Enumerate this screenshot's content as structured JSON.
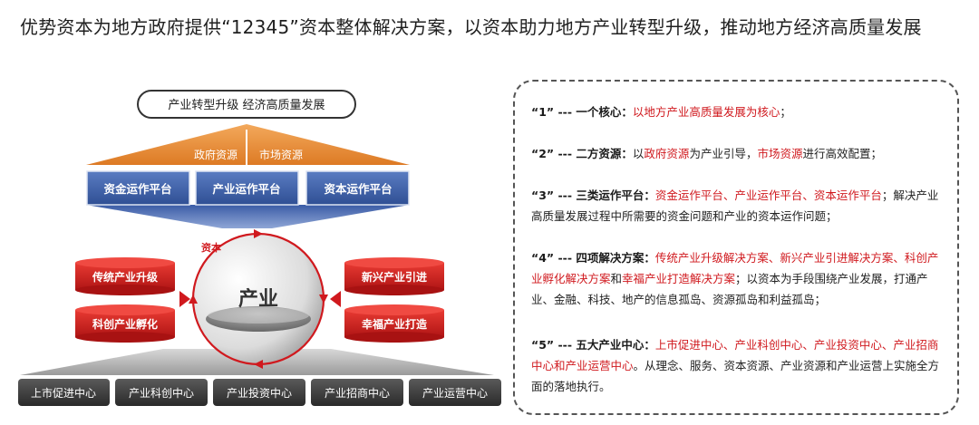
{
  "page": {
    "title": "优势资本为地方政府提供“12345”资本整体解决方案，以资本助力地方产业转型升级，推动地方经济高质量发展"
  },
  "colors": {
    "orange": "#e88a33",
    "blue": "#3d5fa8",
    "red": "#d0191e",
    "dark": "#3a3a3a"
  },
  "diagram": {
    "top_label": "产业转型升级 经济高质量发展",
    "roof_left": "政府资源",
    "roof_right": "市场资源",
    "platforms": [
      "资金运作平台",
      "产业运作平台",
      "资本运作平台"
    ],
    "capital_label": "资本",
    "core_label": "产业",
    "left_items": [
      "传统产业升级",
      "科创产业孵化"
    ],
    "right_items": [
      "新兴产业引进",
      "幸福产业打造"
    ],
    "centers": [
      "上市促进中心",
      "产业科创中心",
      "产业投资中心",
      "产业招商中心",
      "产业运营中心"
    ]
  },
  "points": [
    {
      "head": "“1” --- 一个核心：",
      "segments": [
        {
          "text": "以地方产业高质量发展为核心",
          "red": true
        },
        {
          "text": "；",
          "red": false
        }
      ]
    },
    {
      "head": "“2” --- 二方资源：",
      "segments": [
        {
          "text": "以",
          "red": false
        },
        {
          "text": "政府资源",
          "red": true
        },
        {
          "text": "为产业引导，",
          "red": false
        },
        {
          "text": "市场资源",
          "red": true
        },
        {
          "text": "进行高效配置；",
          "red": false
        }
      ]
    },
    {
      "head": "“3” --- 三类运作平台：",
      "segments": [
        {
          "text": "资金运作平台、产业运作平台、资本运作平台",
          "red": true
        },
        {
          "text": "；解决产业高质量发展过程中所需要的资金问题和产业的资本运作问题；",
          "red": false
        }
      ]
    },
    {
      "head": "“4” --- 四项解决方案：",
      "segments": [
        {
          "text": "传统产业升级解决方案、新兴产业引进解决方案、科创产业孵化解决方案",
          "red": true
        },
        {
          "text": "和",
          "red": false
        },
        {
          "text": "幸福产业打造解决方案",
          "red": true
        },
        {
          "text": "；以资本为手段围绕产业发展，打通产业、金融、科技、地产的信息孤岛、资源孤岛和利益孤岛；",
          "red": false
        }
      ]
    },
    {
      "head": "“5” --- 五大产业中心：",
      "segments": [
        {
          "text": "上市促进中心、产业科创中心、产业投资中心、产业招商中心和产业运营中心",
          "red": true
        },
        {
          "text": "。从理念、服务、资本资源、产业资源和产业运营上实施全方面的落地执行。",
          "red": false
        }
      ]
    }
  ]
}
